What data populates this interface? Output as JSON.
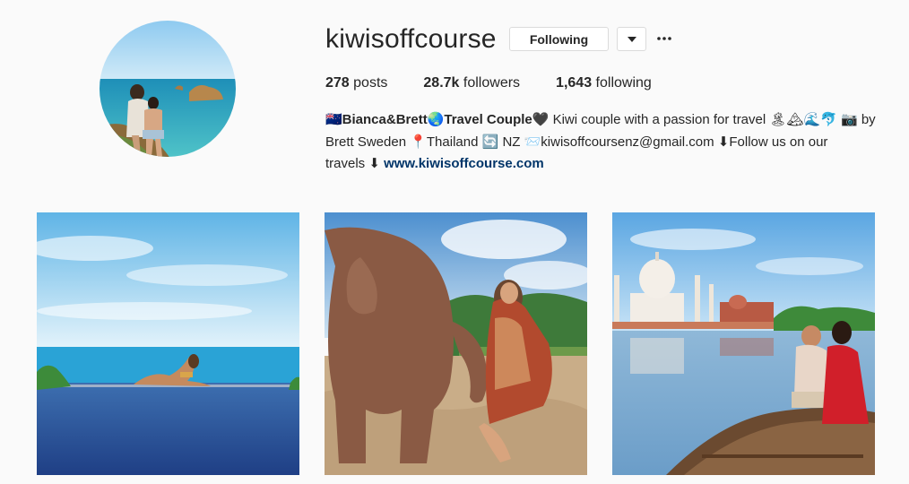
{
  "profile": {
    "username": "kiwisoffcourse",
    "follow_label": "Following",
    "stats": {
      "posts_count": "278",
      "posts_label": "posts",
      "followers_count": "28.7k",
      "followers_label": "followers",
      "following_count": "1,643",
      "following_label": "following"
    },
    "bio": {
      "name": "🇳🇿Bianca&Brett🌏Travel Couple🖤",
      "line1_rest": " Kiwi couple with a passion for travel 🏝🏔🌊🐬 📷 by",
      "line2": "Brett Sweden 📍Thailand 🔄 NZ 📨kiwisoffcoursenz@gmail.com ⬇Follow us on our",
      "line3": "travels ⬇ ",
      "link": "www.kiwisoffcourse.com"
    }
  },
  "icons": {
    "dropdown": "chevron-down-icon",
    "more": "ellipsis-icon"
  },
  "posts": [
    {
      "name": "post-infinity-pool"
    },
    {
      "name": "post-elephant"
    },
    {
      "name": "post-taj-mahal"
    }
  ],
  "colors": {
    "background": "#fafafa",
    "text": "#262626",
    "link": "#003569",
    "border": "#dbdbdb"
  }
}
